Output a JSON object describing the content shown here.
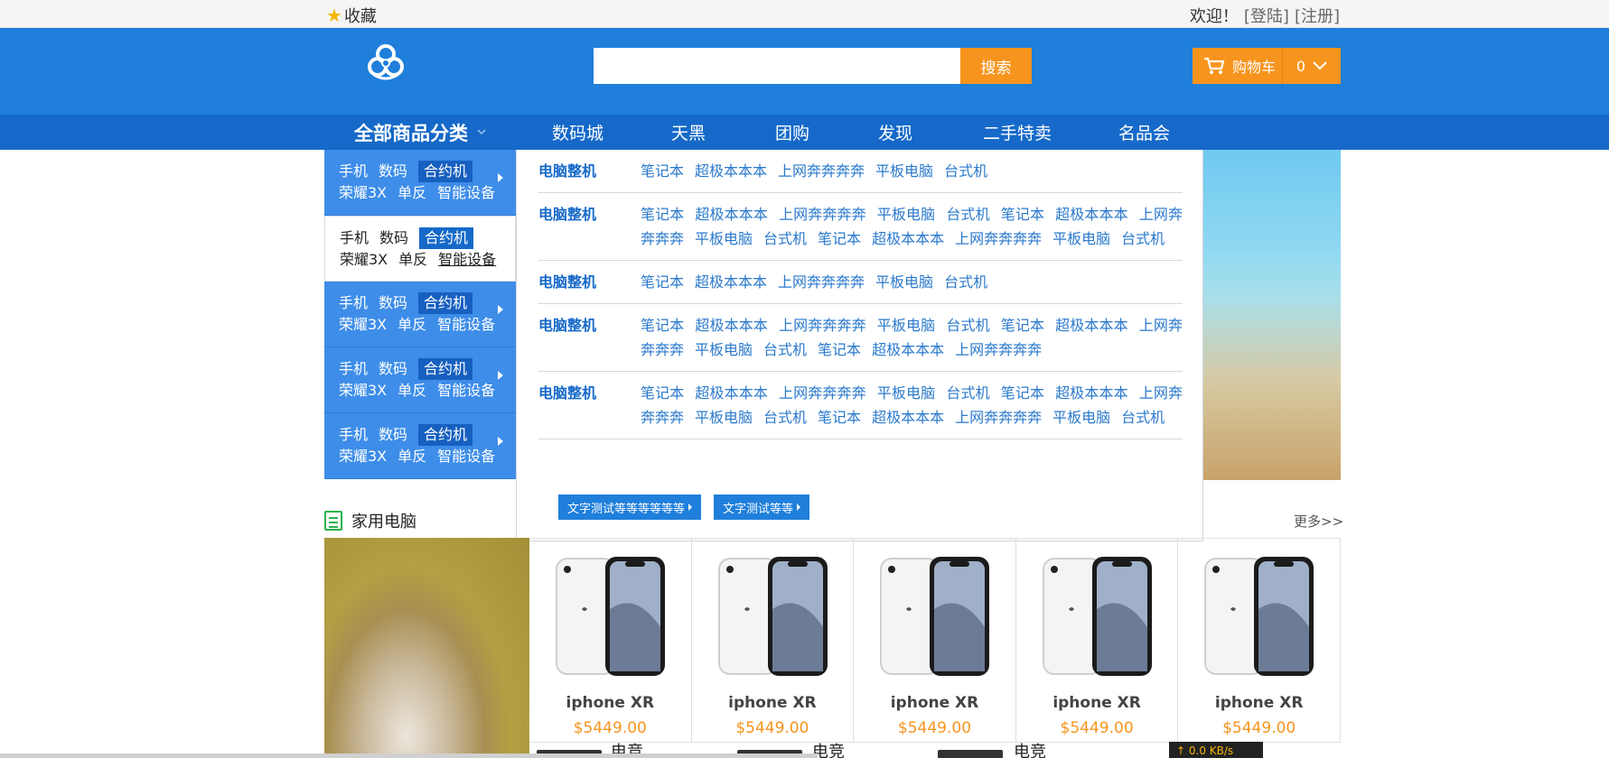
{
  "topbar": {
    "favorite_label": "收藏",
    "welcome": "欢迎！",
    "login": "[登陆]",
    "register": "[注册]"
  },
  "header": {
    "logo_icon": "biohazard-icon",
    "search_placeholder": "",
    "search_button": "搜索",
    "cart_label": "购物车",
    "cart_count": "0"
  },
  "nav": {
    "all_categories": "全部商品分类",
    "items": [
      "数码城",
      "天黑",
      "团购",
      "发现",
      "二手特卖",
      "名品会"
    ]
  },
  "category_menu": [
    {
      "line1": [
        "手机",
        "数码"
      ],
      "tag": "合约机",
      "line2": [
        "荣耀3X",
        "单反",
        "智能设备"
      ],
      "active": false
    },
    {
      "line1": [
        "手机",
        "数码"
      ],
      "tag": "合约机",
      "line2": [
        "荣耀3X",
        "单反",
        "智能设备"
      ],
      "active": true
    },
    {
      "line1": [
        "手机",
        "数码"
      ],
      "tag": "合约机",
      "line2": [
        "荣耀3X",
        "单反",
        "智能设备"
      ],
      "active": false
    },
    {
      "line1": [
        "手机",
        "数码"
      ],
      "tag": "合约机",
      "line2": [
        "荣耀3X",
        "单反",
        "智能设备"
      ],
      "active": false
    },
    {
      "line1": [
        "手机",
        "数码"
      ],
      "tag": "合约机",
      "line2": [
        "荣耀3X",
        "单反",
        "智能设备"
      ],
      "active": false
    }
  ],
  "panel": {
    "rows": [
      {
        "title": "电脑整机",
        "links": [
          "笔记本",
          "超极本本本",
          "上网奔奔奔奔",
          "平板电脑",
          "台式机"
        ]
      },
      {
        "title": "电脑整机",
        "links": [
          "笔记本",
          "超极本本本",
          "上网奔奔奔奔",
          "平板电脑",
          "台式机",
          "笔记本",
          "超极本本本",
          "上网奔奔奔奔",
          "平板电脑",
          "台式机",
          "笔记本",
          "超极本本本",
          "上网奔奔奔奔",
          "平板电脑",
          "台式机"
        ]
      },
      {
        "title": "电脑整机",
        "links": [
          "笔记本",
          "超极本本本",
          "上网奔奔奔奔",
          "平板电脑",
          "台式机"
        ]
      },
      {
        "title": "电脑整机",
        "links": [
          "笔记本",
          "超极本本本",
          "上网奔奔奔奔",
          "平板电脑",
          "台式机",
          "笔记本",
          "超极本本本",
          "上网奔奔奔奔",
          "平板电脑",
          "台式机",
          "笔记本",
          "超极本本本",
          "上网奔奔奔奔"
        ]
      },
      {
        "title": "电脑整机",
        "links": [
          "笔记本",
          "超极本本本",
          "上网奔奔奔奔",
          "平板电脑",
          "台式机",
          "笔记本",
          "超极本本本",
          "上网奔奔奔奔",
          "平板电脑",
          "台式机",
          "笔记本",
          "超极本本本",
          "上网奔奔奔奔",
          "平板电脑",
          "台式机"
        ]
      }
    ],
    "buttons": [
      "文字测试等等等等等等",
      "文字测试等等"
    ]
  },
  "section": {
    "title": "家用电脑",
    "more": "更多>>",
    "products": [
      {
        "name": "iphone XR",
        "price": "$5449.00"
      },
      {
        "name": "iphone XR",
        "price": "$5449.00"
      },
      {
        "name": "iphone XR",
        "price": "$5449.00"
      },
      {
        "name": "iphone XR",
        "price": "$5449.00"
      },
      {
        "name": "iphone XR",
        "price": "$5449.00"
      }
    ],
    "bottom_labels": [
      "电竞",
      "电竞",
      "电竞"
    ]
  },
  "netmeter": "↑ 0.0 KB/s",
  "colors": {
    "primary": "#1f7fdb",
    "nav": "#1669c9",
    "accent": "#f7941d",
    "category": "#3d8de9"
  }
}
